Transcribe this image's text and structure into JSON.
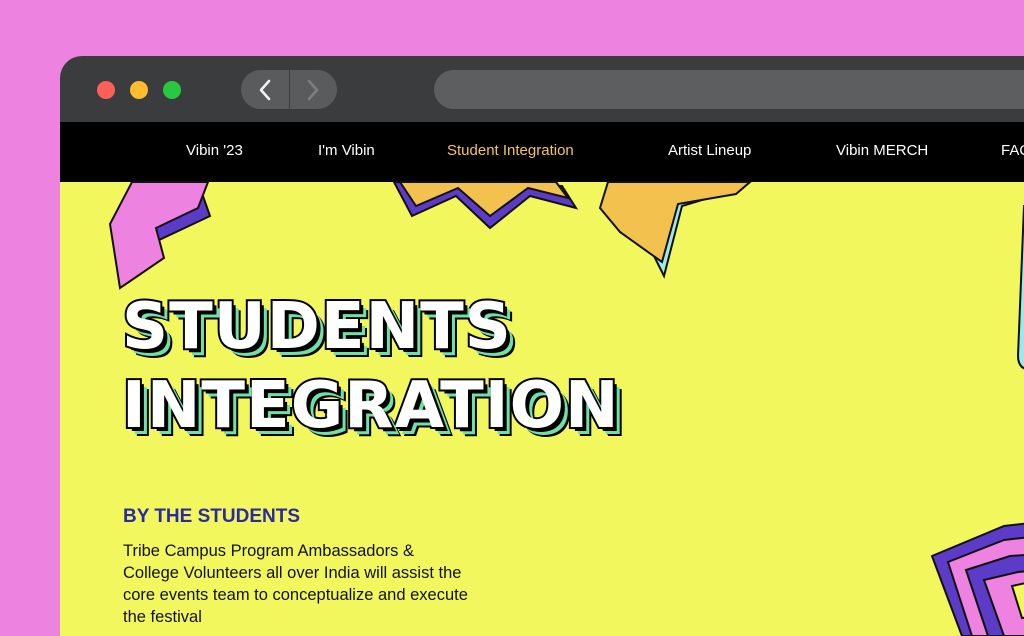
{
  "nav": {
    "items": [
      {
        "label": "Vibin '23"
      },
      {
        "label": "I'm Vibin"
      },
      {
        "label": "Student Integration"
      },
      {
        "label": "Artist Lineup"
      },
      {
        "label": "Vibin MERCH"
      },
      {
        "label": "FAQ"
      }
    ],
    "active_index": 2
  },
  "hero": {
    "line1": "STUDENTS",
    "line2": "INTEGRATION"
  },
  "section": {
    "subheading": "BY THE STUDENTS",
    "body": "Tribe Campus Program Ambassadors & College Volunteers all over India will assist the core events team to conceptualize and execute the festival"
  },
  "colors": {
    "page_background": "#ee82e0",
    "content_background": "#f2f75e",
    "nav_background": "#000000",
    "nav_active": "#f7c35b",
    "subheading": "#2a2aa5"
  },
  "icons": [
    "back-chevron-icon",
    "forward-chevron-icon"
  ]
}
